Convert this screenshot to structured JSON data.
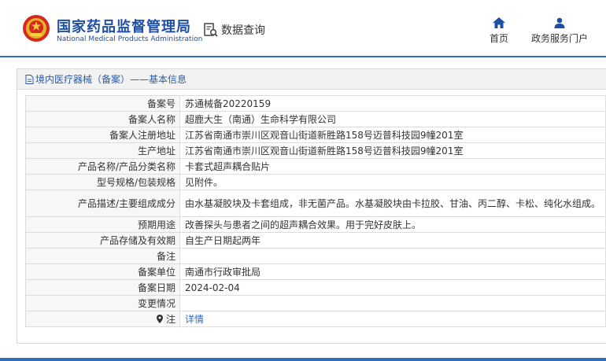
{
  "header": {
    "brand_cn": "国家药品监督管理局",
    "brand_en": "National Medical Products Administration",
    "query_label": "数据查询",
    "nav": {
      "home": "首页",
      "portal": "政务服务门户"
    }
  },
  "breadcrumb": {
    "title": "境内医疗器械（备案）——基本信息"
  },
  "record": [
    {
      "label": "备案号",
      "value": "苏通械备20220159"
    },
    {
      "label": "备案人名称",
      "value": "超鹿大生（南通）生命科学有限公司"
    },
    {
      "label": "备案人注册地址",
      "value": "江苏省南通市崇川区观音山街道新胜路158号迈普科技园9幢201室"
    },
    {
      "label": "生产地址",
      "value": "江苏省南通市崇川区观音山街道新胜路158号迈普科技园9幢201室"
    },
    {
      "label": "产品名称/产品分类名称",
      "value": "卡套式超声耦合贴片"
    },
    {
      "label": "型号规格/包装规格",
      "value": "见附件。"
    },
    {
      "label": "产品描述/主要组成成分",
      "value": "由水基凝胶块及卡套组成，非无菌产品。水基凝胶块由卡拉胶、甘油、丙二醇、卡松、纯化水组成。"
    },
    {
      "label": "预期用途",
      "value": "改善探头与患者之间的超声耦合效果。用于完好皮肤上。"
    },
    {
      "label": "产品存储及有效期",
      "value": "自生产日期起两年"
    },
    {
      "label": "备注",
      "value": ""
    },
    {
      "label": "备案单位",
      "value": "南通市行政审批局"
    },
    {
      "label": "备案日期",
      "value": "2024-02-04"
    },
    {
      "label": "变更情况",
      "value": ""
    }
  ],
  "note": {
    "label": "注",
    "link": "详情"
  },
  "colors": {
    "brand_blue": "#1f4fa3",
    "link_blue": "#2a6bc2",
    "accent": "#2f6fbf"
  }
}
